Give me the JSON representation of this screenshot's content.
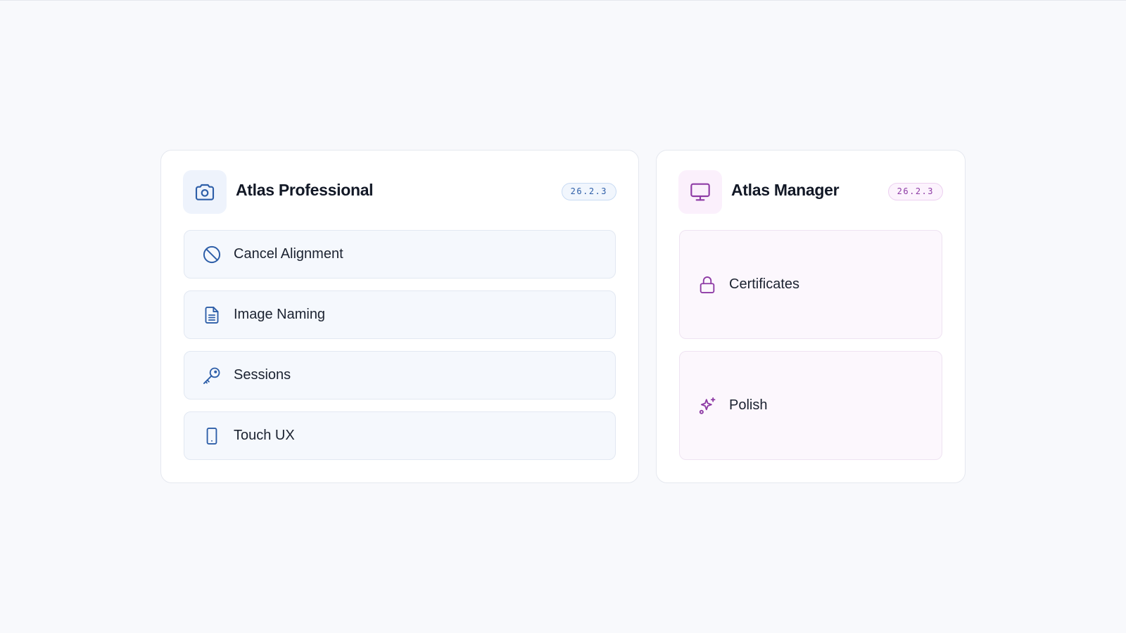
{
  "colors": {
    "page_background": "#f8f9fc",
    "pro_accent": "#2d5ea8",
    "manager_accent": "#8e3ba5"
  },
  "cards": [
    {
      "title": "Atlas Professional",
      "version": "26.2.3",
      "header_icon": "camera-icon",
      "items": [
        {
          "label": "Cancel Alignment",
          "icon": "ban-icon"
        },
        {
          "label": "Image Naming",
          "icon": "file-text-icon"
        },
        {
          "label": "Sessions",
          "icon": "key-icon"
        },
        {
          "label": "Touch UX",
          "icon": "smartphone-icon"
        }
      ]
    },
    {
      "title": "Atlas Manager",
      "version": "26.2.3",
      "header_icon": "monitor-icon",
      "items": [
        {
          "label": "Certificates",
          "icon": "lock-icon"
        },
        {
          "label": "Polish",
          "icon": "sparkles-icon"
        }
      ]
    }
  ]
}
